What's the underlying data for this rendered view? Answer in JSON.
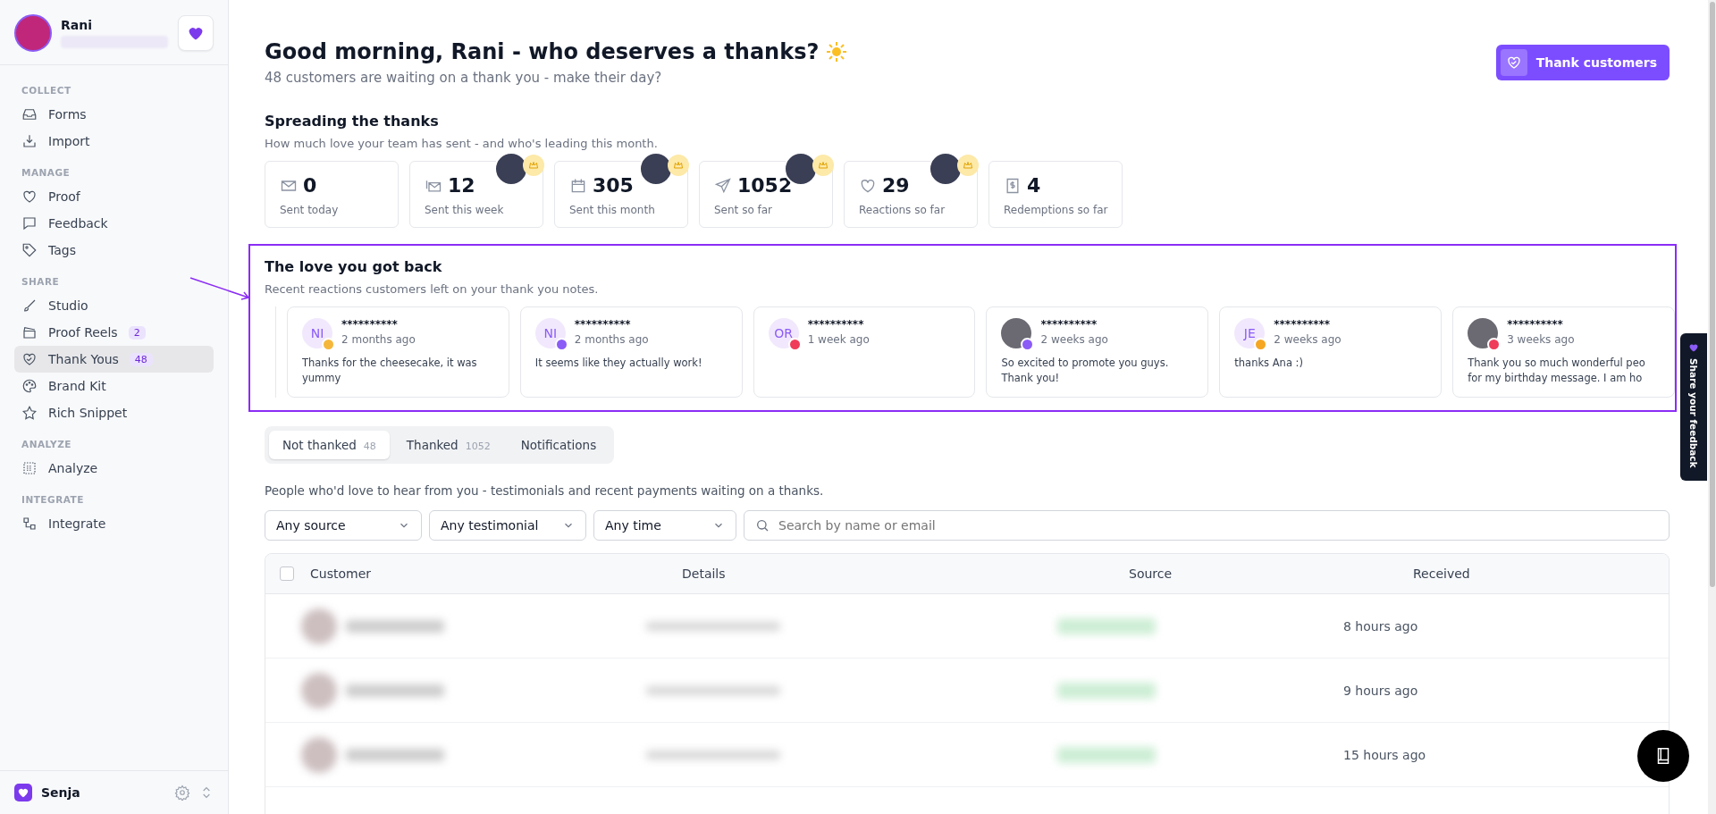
{
  "user": {
    "name": "Rani"
  },
  "sidebar": {
    "sections": [
      {
        "title": "COLLECT",
        "items": [
          {
            "label": "Forms",
            "selected": false
          },
          {
            "label": "Import",
            "selected": false
          }
        ]
      },
      {
        "title": "MANAGE",
        "items": [
          {
            "label": "Proof",
            "selected": false
          },
          {
            "label": "Feedback",
            "selected": false
          },
          {
            "label": "Tags",
            "selected": false
          }
        ]
      },
      {
        "title": "SHARE",
        "items": [
          {
            "label": "Studio",
            "selected": false
          },
          {
            "label": "Proof Reels",
            "badge": "2",
            "selected": false
          },
          {
            "label": "Thank Yous",
            "badge": "48",
            "selected": true
          },
          {
            "label": "Brand Kit",
            "selected": false
          },
          {
            "label": "Rich Snippet",
            "selected": false
          }
        ]
      },
      {
        "title": "ANALYZE",
        "items": [
          {
            "label": "Analyze",
            "selected": false
          }
        ]
      },
      {
        "title": "INTEGRATE",
        "items": [
          {
            "label": "Integrate",
            "selected": false
          }
        ]
      }
    ],
    "workspace": "Senja"
  },
  "header": {
    "title": "Good morning, Rani - who deserves a thanks?",
    "subtitle": "48 customers are waiting on a thank you - make their day?",
    "button": "Thank customers"
  },
  "stats": {
    "title": "Spreading the thanks",
    "subtitle": "How much love your team has sent - and who's leading this month.",
    "cards": [
      {
        "value": "0",
        "label": "Sent today",
        "leader": false
      },
      {
        "value": "12",
        "label": "Sent this week",
        "leader": true
      },
      {
        "value": "305",
        "label": "Sent this month",
        "leader": true
      },
      {
        "value": "1052",
        "label": "Sent so far",
        "leader": true
      },
      {
        "value": "29",
        "label": "Reactions so far",
        "leader": true
      },
      {
        "value": "4",
        "label": "Redemptions so far",
        "leader": false
      }
    ]
  },
  "reactions": {
    "title": "The love you got back",
    "subtitle": "Recent reactions customers left on your thank you notes.",
    "cards": [
      {
        "initials": "NI",
        "name": "**********",
        "time": "2 months ago",
        "message": "Thanks for the cheesecake, it was yummy"
      },
      {
        "initials": "NI",
        "name": "**********",
        "time": "2 months ago",
        "message": "It seems like they actually work!"
      },
      {
        "initials": "OR",
        "name": "**********",
        "time": "1 week ago"
      },
      {
        "name": "**********",
        "time": "2 weeks ago",
        "message": "So excited to promote you guys. Thank you!"
      },
      {
        "initials": "JE",
        "name": "**********",
        "time": "2 weeks ago",
        "message": "thanks Ana :)"
      },
      {
        "name": "**********",
        "time": "3 weeks ago",
        "message": "Thank you so much wonderful peo for my birthday message. I am ho"
      }
    ]
  },
  "tabs": [
    {
      "label": "Not thanked",
      "count": "48",
      "selected": true
    },
    {
      "label": "Thanked",
      "count": "1052",
      "selected": false
    },
    {
      "label": "Notifications",
      "selected": false
    }
  ],
  "description": "People who'd love to hear from you - testimonials and recent payments waiting on a thanks.",
  "filters": [
    {
      "label": "Any source"
    },
    {
      "label": "Any testimonial"
    },
    {
      "label": "Any time"
    }
  ],
  "search": {
    "placeholder": "Search by name or email"
  },
  "table": {
    "select_all": {
      "checked": false
    },
    "columns": [
      "Customer",
      "Details",
      "Source",
      "Received"
    ],
    "rows": [
      {
        "received": "8 hours ago"
      },
      {
        "received": "9 hours ago"
      },
      {
        "received": "15 hours ago"
      }
    ]
  },
  "feedback_tab": "Share your feedback"
}
